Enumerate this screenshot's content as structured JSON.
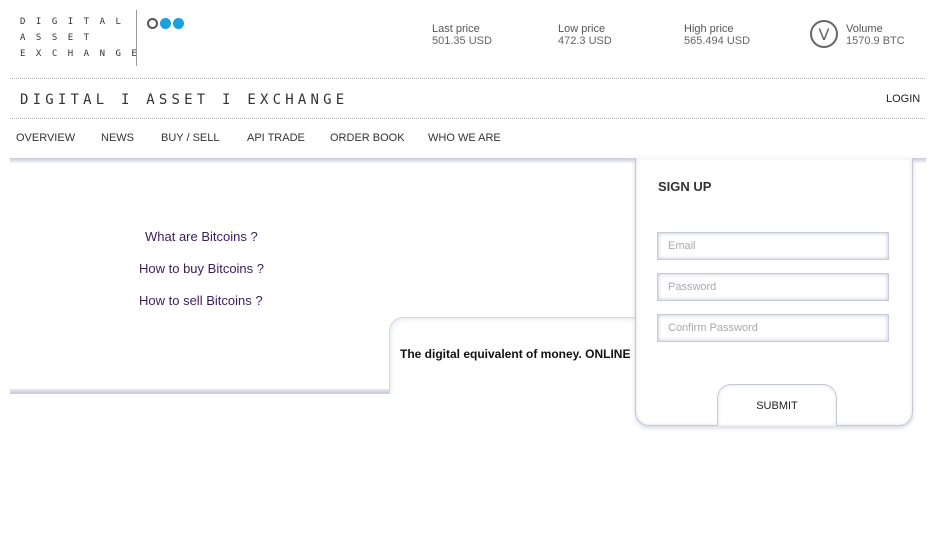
{
  "logo": {
    "lines": [
      "DIGITAL",
      "ASSET",
      "EXCHANGE"
    ]
  },
  "stats": [
    {
      "label": "Last price",
      "value": "501.35 USD"
    },
    {
      "label": "Low price",
      "value": "472.3 USD"
    },
    {
      "label": "High price",
      "value": "565.494 USD"
    },
    {
      "label": "Volume",
      "value": "1570.9 BTC"
    }
  ],
  "volume_icon_letter": "V",
  "brand": "DIGITAL I ASSET I EXCHANGE",
  "login": "LOGIN",
  "nav": [
    "OVERVIEW",
    "NEWS",
    "BUY / SELL",
    "API TRADE",
    "ORDER BOOK",
    "WHO WE ARE"
  ],
  "faq": [
    "What are Bitcoins ?",
    "How to buy Bitcoins ?",
    "How to sell Bitcoins ?"
  ],
  "tagline": "The digital equivalent of money. ONLINE",
  "signup": {
    "title": "SIGN UP",
    "email_placeholder": "Email",
    "password_placeholder": "Password",
    "confirm_placeholder": "Confirm Password",
    "submit": "SUBMIT"
  },
  "colors": {
    "accent": "#1a9fe0",
    "faq_text": "#3a1d5c"
  }
}
